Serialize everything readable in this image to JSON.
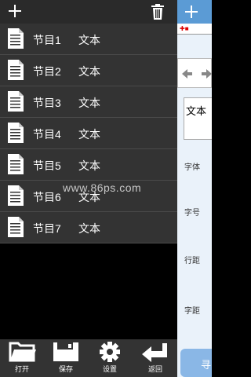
{
  "list": {
    "items": [
      {
        "name": "节目1",
        "text": "文本"
      },
      {
        "name": "节目2",
        "text": "文本"
      },
      {
        "name": "节目3",
        "text": "文本"
      },
      {
        "name": "节目4",
        "text": "文本"
      },
      {
        "name": "节目5",
        "text": "文本"
      },
      {
        "name": "节目6",
        "text": "文本"
      },
      {
        "name": "节目7",
        "text": "文本"
      }
    ]
  },
  "watermark": "www.86ps.com",
  "bottom": {
    "open": "打开",
    "save": "保存",
    "settings": "设置",
    "back": "返回"
  },
  "right_panel": {
    "preview_text": "文本",
    "labels": {
      "font": "字体",
      "size": "字号",
      "line_spacing": "行距",
      "char_spacing": "字距"
    },
    "button": "寻"
  },
  "colors": {
    "accent": "#5b9bd5",
    "row_bg": "#333333",
    "panel_bg": "#eaf2fa"
  }
}
